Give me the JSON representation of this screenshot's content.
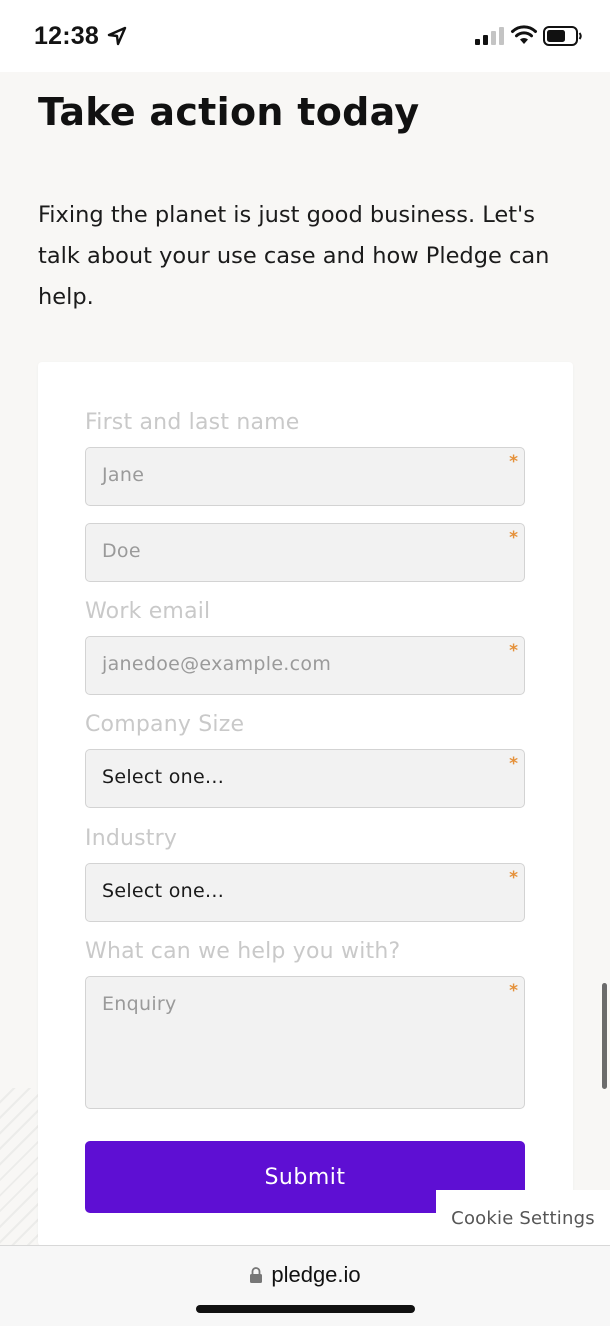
{
  "status_bar": {
    "time": "12:38",
    "icons": [
      "location-arrow-icon",
      "cellular-signal-icon",
      "wifi-icon",
      "battery-icon"
    ]
  },
  "page": {
    "title": "Take action today",
    "intro": "Fixing the planet is just good business. Let's talk about your use case and how Pledge can help."
  },
  "form": {
    "name_label": "First and last name",
    "first_name_placeholder": "Jane",
    "last_name_placeholder": "Doe",
    "email_label": "Work email",
    "email_placeholder": "janedoe@example.com",
    "company_size_label": "Company Size",
    "company_size_value": "Select one...",
    "industry_label": "Industry",
    "industry_value": "Select one...",
    "help_label": "What can we help you with?",
    "enquiry_placeholder": "Enquiry",
    "required_mark": "*",
    "submit_label": "Submit"
  },
  "cookie_settings_label": "Cookie Settings",
  "browser": {
    "url": "pledge.io"
  },
  "colors": {
    "accent": "#5e0fd3",
    "required": "#e5913a",
    "background": "#f8f7f5"
  }
}
